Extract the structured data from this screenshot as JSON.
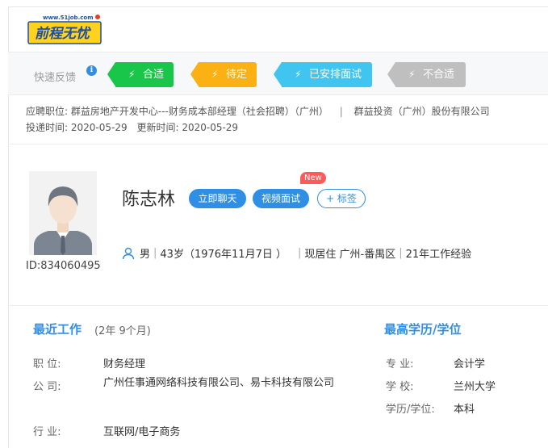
{
  "logo": {
    "url_text": "www.51job.com",
    "brand": "前程无忧"
  },
  "feedback": {
    "label": "快速反馈",
    "info_glyph": "i",
    "buttons": [
      {
        "label": "合适",
        "color": "#1ac64a"
      },
      {
        "label": "待定",
        "color": "#fbb013"
      },
      {
        "label": "已安排面试",
        "color": "#3fc5ef"
      },
      {
        "label": "不合适",
        "color": "#bfbfbf"
      }
    ]
  },
  "job": {
    "position_label": "应聘职位:",
    "position": "群益房地产开发中心---财务成本部经理（社会招聘）（广州）",
    "company": "群益投资（广州）股份有限公司",
    "apply_label": "投递时间:",
    "apply_time": "2020-05-29",
    "update_label": "更新时间:",
    "update_time": "2020-05-29"
  },
  "profile": {
    "name": "陈志林",
    "id_text": "ID:834060495",
    "chat_button": "立即聊天",
    "video_button": "视频面试",
    "tag_button": "+ 标签",
    "new_badge": "New",
    "gender": "男",
    "age": "43岁（1976年11月7日 ）",
    "residence": "现居住 广州-番禺区",
    "experience": "21年工作经验"
  },
  "recent_work": {
    "title": "最近工作",
    "duration": "(2年 9个月)",
    "fields": [
      {
        "label": "职    位:",
        "value": "财务经理"
      },
      {
        "label": "公    司:",
        "value": "广州任事通网络科技有限公司、易卡科技有限公司"
      },
      {
        "label": "行    业:",
        "value": "互联网/电子商务"
      }
    ]
  },
  "education": {
    "title": "最高学历/学位",
    "fields": [
      {
        "label": "专    业:",
        "value": "会计学"
      },
      {
        "label": "学    校:",
        "value": "兰州大学"
      },
      {
        "label": "学历/学位:",
        "value": "本科"
      }
    ]
  }
}
